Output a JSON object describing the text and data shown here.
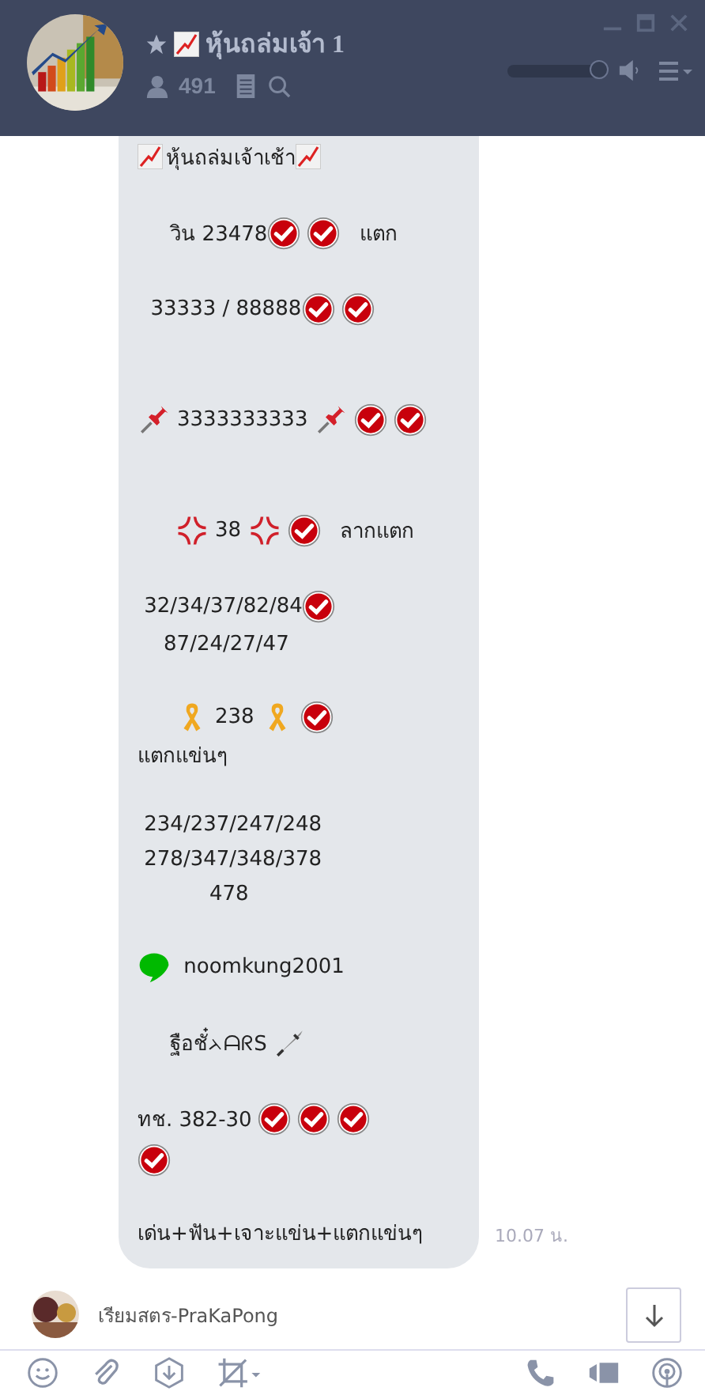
{
  "header": {
    "starred": true,
    "title": "หุ้นถล่มเจ้า 1",
    "member_count": "491",
    "volume": {
      "level": 0.97
    }
  },
  "message": {
    "lines": [
      [
        {
          "kind": "chart"
        },
        {
          "kind": "text",
          "text": "หุ้นถล่มเจ้าเช้า"
        },
        {
          "kind": "chart"
        }
      ],
      [
        {
          "kind": "blank"
        }
      ],
      [
        {
          "kind": "text",
          "text": "     วิน 23478"
        },
        {
          "kind": "check"
        },
        {
          "kind": "check"
        },
        {
          "kind": "text",
          "text": "  แตก"
        }
      ],
      [
        {
          "kind": "blank"
        }
      ],
      [
        {
          "kind": "text",
          "text": "  33333 / 88888"
        },
        {
          "kind": "check"
        },
        {
          "kind": "check"
        }
      ],
      [
        {
          "kind": "blank"
        }
      ],
      [
        {
          "kind": "blank"
        }
      ],
      [
        {
          "kind": "pin"
        },
        {
          "kind": "text",
          "text": "3333333333 "
        },
        {
          "kind": "pin"
        },
        {
          "kind": "check"
        },
        {
          "kind": "check"
        }
      ],
      [
        {
          "kind": "blank"
        }
      ],
      [
        {
          "kind": "blank"
        }
      ],
      [
        {
          "kind": "space"
        },
        {
          "kind": "anger"
        },
        {
          "kind": "text",
          "text": "38 "
        },
        {
          "kind": "anger"
        },
        {
          "kind": "check"
        },
        {
          "kind": "text",
          "text": "  ลากแตก"
        }
      ],
      [
        {
          "kind": "blank"
        }
      ],
      [
        {
          "kind": "text",
          "text": " 32/34/37/82/84"
        },
        {
          "kind": "check"
        }
      ],
      [
        {
          "kind": "text",
          "text": "    87/24/27/47"
        }
      ],
      [
        {
          "kind": "blank"
        }
      ],
      [
        {
          "kind": "space"
        },
        {
          "kind": "ribbon"
        },
        {
          "kind": "text",
          "text": "238 "
        },
        {
          "kind": "ribbon"
        },
        {
          "kind": "check"
        }
      ],
      [
        {
          "kind": "text",
          "text": "แตกแข่นๆ"
        }
      ],
      [
        {
          "kind": "blank"
        }
      ],
      [
        {
          "kind": "text",
          "text": " 234/237/247/248"
        }
      ],
      [
        {
          "kind": "text",
          "text": " 278/347/348/378"
        }
      ],
      [
        {
          "kind": "text",
          "text": "           478"
        }
      ],
      [
        {
          "kind": "blank"
        }
      ],
      [
        {
          "kind": "line-logo"
        },
        {
          "kind": "text",
          "text": " noomkung2001"
        }
      ],
      [
        {
          "kind": "blank"
        }
      ],
      [
        {
          "kind": "text",
          "text": "     ฐือชั๋ᨂᗩᖇS "
        },
        {
          "kind": "dagger"
        }
      ],
      [
        {
          "kind": "blank"
        }
      ],
      [
        {
          "kind": "text",
          "text": "ทช. 382-30 "
        },
        {
          "kind": "check"
        },
        {
          "kind": "check"
        },
        {
          "kind": "check"
        }
      ],
      [
        {
          "kind": "check"
        }
      ],
      [
        {
          "kind": "blank"
        }
      ],
      [
        {
          "kind": "text",
          "text": "เด่น+ฟัน+เจาะแข่น+แตกแข่นๆ"
        }
      ]
    ],
    "time": "10.07 น."
  },
  "next_sender": {
    "name": "เรียมสตร-PraKaPong"
  }
}
